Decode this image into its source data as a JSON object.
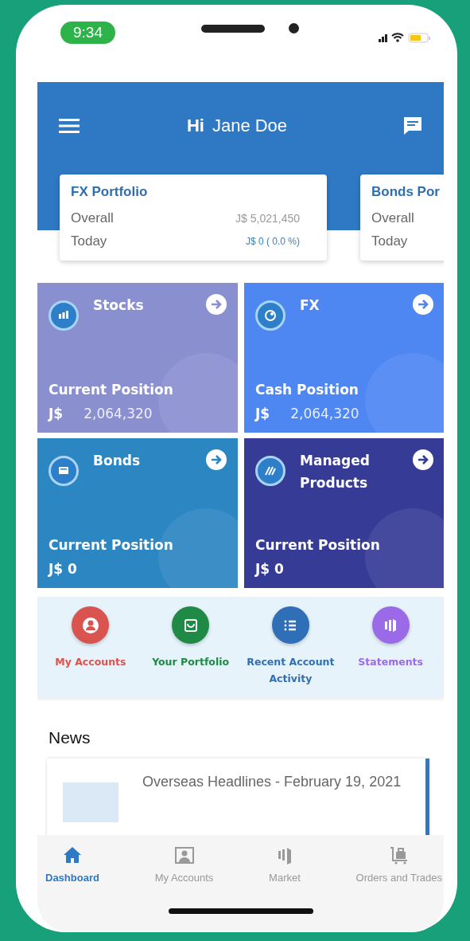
{
  "status_bar": {
    "time": "9:34"
  },
  "header": {
    "greeting": "Hi",
    "name": "Jane Doe"
  },
  "portfolio_cards": [
    {
      "title": "FX Portfolio",
      "rows": [
        {
          "label": "Overall",
          "value": "J$ 5,021,450"
        },
        {
          "label": "Today",
          "value": "J$ 0 ( 0.0 %)"
        }
      ]
    },
    {
      "title": "Bonds Por",
      "rows": [
        {
          "label": "Overall"
        },
        {
          "label": "Today"
        }
      ]
    }
  ],
  "tiles": [
    {
      "kind": "stocks",
      "title": "Stocks",
      "label": "Current Position",
      "currency": "J$",
      "amount": "2,064,320",
      "color": "#8a8fd0"
    },
    {
      "kind": "fx",
      "title": "FX",
      "label": "Cash Position",
      "currency": "J$",
      "amount": "2,064,320",
      "color": "#4e86f2"
    },
    {
      "kind": "bonds",
      "title": "Bonds",
      "label": "Current Position",
      "amount": "J$ 0",
      "color": "#2b86c2"
    },
    {
      "kind": "managed",
      "title": "Managed Products",
      "label": "Current Position",
      "amount": "J$ 0",
      "color": "#363b96"
    }
  ],
  "quick_links": [
    {
      "kind": "person",
      "label": "My Accounts",
      "color": "#d9534f"
    },
    {
      "kind": "bag",
      "label": "Your Portfolio",
      "color": "#1e8a45"
    },
    {
      "kind": "list",
      "label": "Recent Account Activity",
      "color": "#2f6fb8"
    },
    {
      "kind": "bars",
      "label": "Statements",
      "color": "#9b6ae8"
    }
  ],
  "news": {
    "title": "News",
    "items": [
      {
        "headline": "Overseas Headlines - February 19, 2021"
      }
    ]
  },
  "bottom_nav": [
    {
      "kind": "home",
      "label": "Dashboard",
      "selected": true
    },
    {
      "kind": "person",
      "label": "My Accounts",
      "selected": false
    },
    {
      "kind": "bars",
      "label": "Market",
      "selected": false
    },
    {
      "kind": "cart",
      "label": "Orders and Trades",
      "selected": false
    }
  ]
}
